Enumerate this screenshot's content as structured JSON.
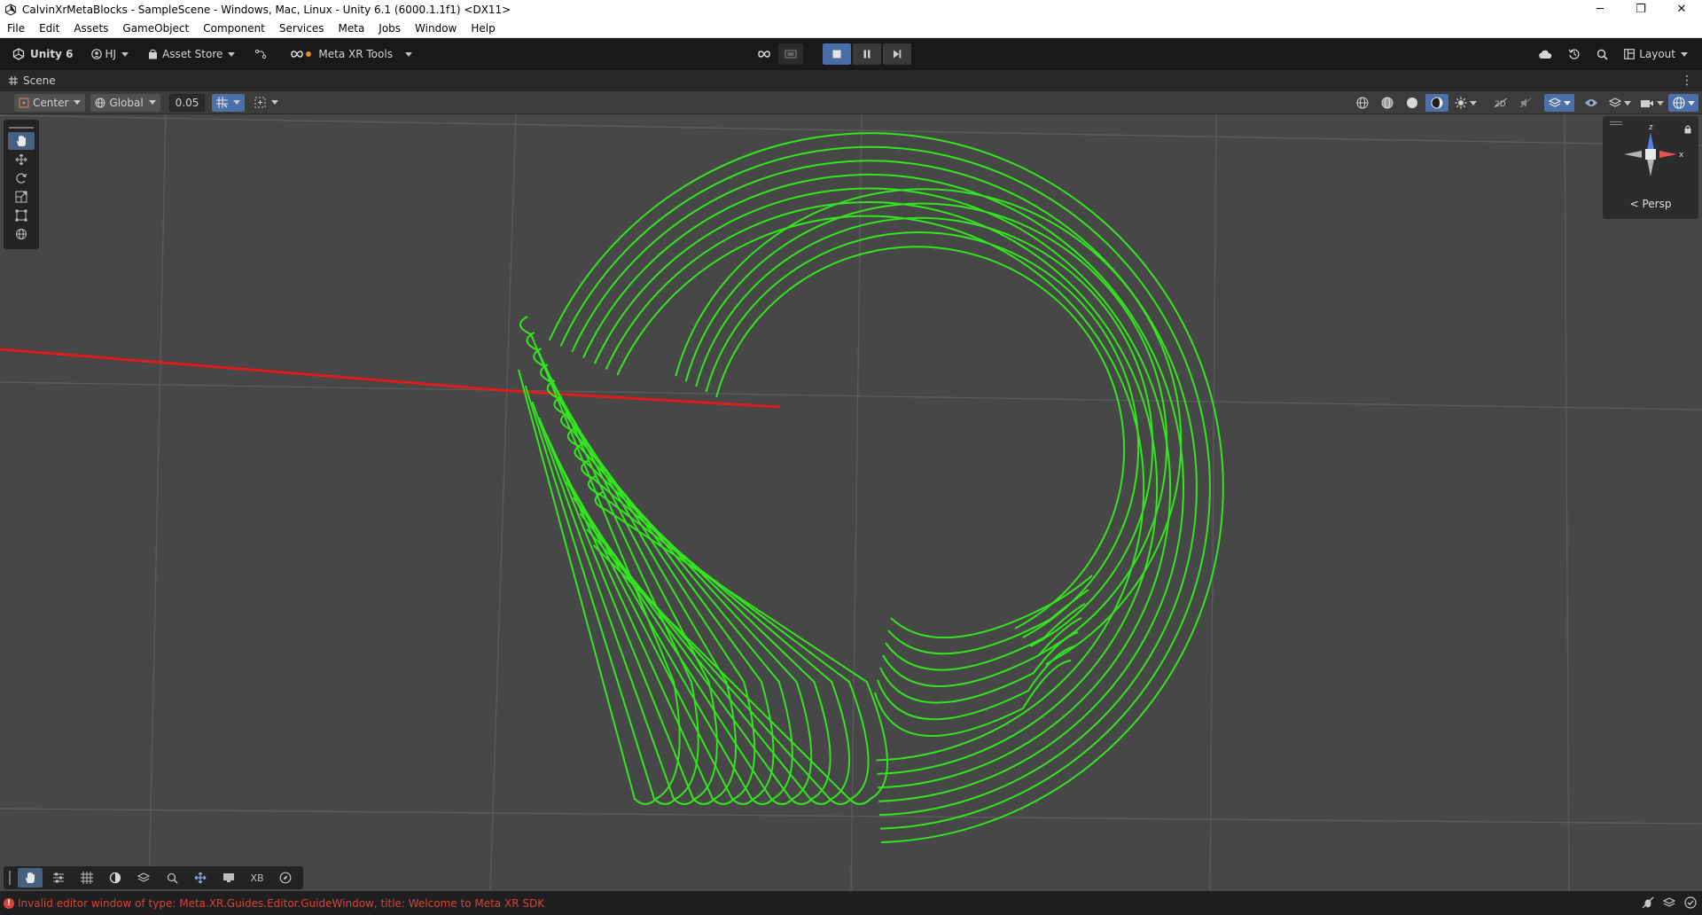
{
  "window": {
    "title": "CalvinXrMetaBlocks - SampleScene - Windows, Mac, Linux - Unity 6.1 (6000.1.1f1) <DX11>",
    "minimize_label": "─",
    "restore_label": "❐",
    "close_label": "✕"
  },
  "menu": {
    "items": [
      "File",
      "Edit",
      "Assets",
      "GameObject",
      "Component",
      "Services",
      "Meta",
      "Jobs",
      "Window",
      "Help"
    ]
  },
  "toolbar": {
    "product_label": "Unity 6",
    "account_label": "HJ",
    "asset_store_label": "Asset Store",
    "meta_tools_label": "Meta XR Tools",
    "layout_label": "Layout",
    "meta_dot_color": "#e88b2a"
  },
  "scene_tab": {
    "label": "Scene"
  },
  "scene_toolbar": {
    "pivot_mode": "Center",
    "pivot_rotation": "Global",
    "snap_value": "0.05"
  },
  "gizmo": {
    "view_label": "Persp",
    "axis_x": "x",
    "axis_z": "z",
    "x_color": "#e0554f",
    "y_color": "#b5b5b5",
    "z_color": "#5b7ee5"
  },
  "overlay_toolbar": {
    "xb_label": "XB"
  },
  "status": {
    "message": "Invalid editor window of type: Meta.XR.Guides.Editor.GuideWindow, title: Welcome to Meta XR SDK",
    "color": "#d9423a"
  },
  "scene": {
    "line_color": "#33e51f",
    "axis_color": "#e61a1a",
    "grid_color": "#5a5a5a",
    "background": "#474747"
  }
}
